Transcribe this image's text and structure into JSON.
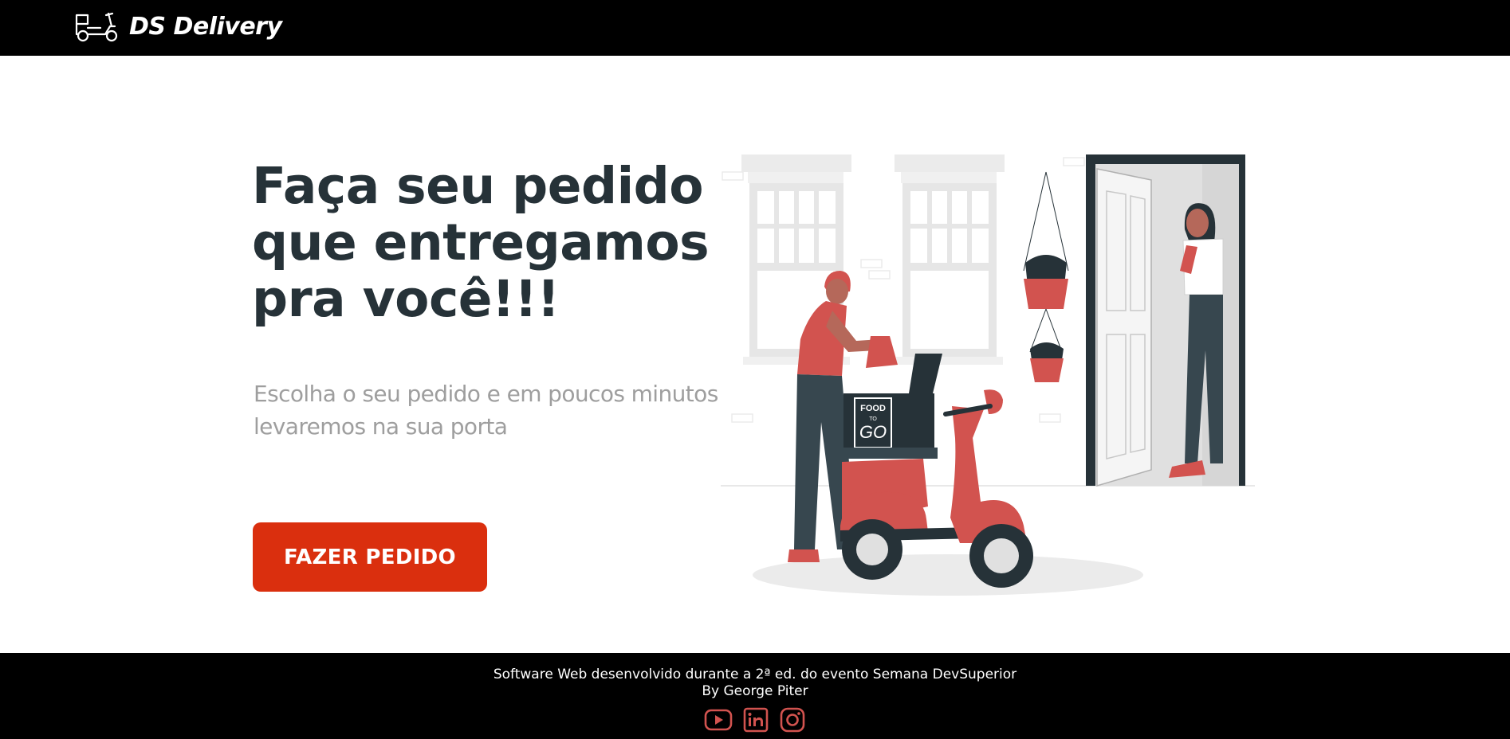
{
  "app": {
    "brand_name": "DS Delivery",
    "brand_icon": "scooter-icon"
  },
  "hero": {
    "title_line1": "Faça seu pedido",
    "title_line2": "que entregamos",
    "title_line3": "pra você!!!",
    "subtitle_line1": "Escolha o seu pedido e em poucos minutos",
    "subtitle_line2": "levaremos na sua porta",
    "cta_label": "FAZER PEDIDO",
    "illustration": "delivery-scooter-illustration",
    "illustration_box_text": {
      "line1": "FOOD",
      "line2": "TO",
      "line3": "GO"
    }
  },
  "footer": {
    "line1": "Software Web desenvolvido durante a 2ª ed. do evento Semana DevSuperior",
    "line2": "By George Piter",
    "social": [
      "youtube-icon",
      "linkedin-icon",
      "instagram-icon"
    ]
  },
  "colors": {
    "navbar_bg": "#000000",
    "primary": "#DA2F0E",
    "title": "#263238",
    "subtitle": "#9E9E9E",
    "social_icons": "#D2534F"
  }
}
